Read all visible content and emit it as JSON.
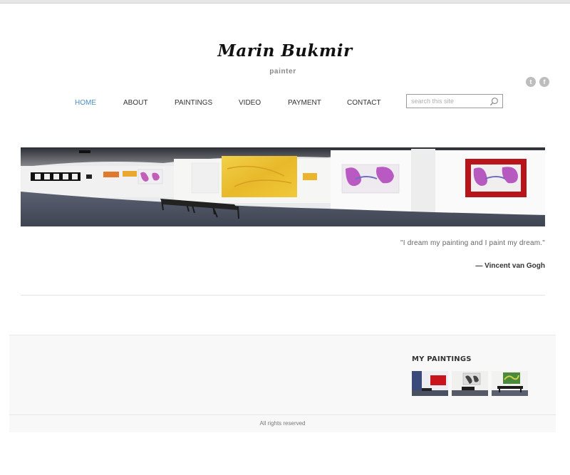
{
  "site": {
    "title": "Marin Bukmir",
    "tagline": "painter"
  },
  "social": [
    {
      "name": "twitter",
      "icon": "twitter-icon",
      "glyph": "t"
    },
    {
      "name": "facebook",
      "icon": "facebook-icon",
      "glyph": "f"
    }
  ],
  "nav": {
    "items": [
      {
        "label": "HOME",
        "active": true
      },
      {
        "label": "ABOUT",
        "active": false
      },
      {
        "label": "PAINTINGS",
        "active": false
      },
      {
        "label": "VIDEO",
        "active": false
      },
      {
        "label": "PAYMENT",
        "active": false
      },
      {
        "label": "CONTACT",
        "active": false
      }
    ],
    "active_color": "#4a8cc2"
  },
  "search": {
    "placeholder": "search this site",
    "icon": "magnifier-icon"
  },
  "quote": {
    "text": "\"I dream my painting and I paint my dream.\"",
    "author": "— Vincent van Gogh"
  },
  "widget": {
    "title": "MY PAINTINGS",
    "thumbnails": [
      {
        "name": "red-painting-thumb"
      },
      {
        "name": "gray-painting-thumb"
      },
      {
        "name": "green-painting-thumb"
      }
    ]
  },
  "footer": {
    "copyright": "All rights reserved"
  }
}
